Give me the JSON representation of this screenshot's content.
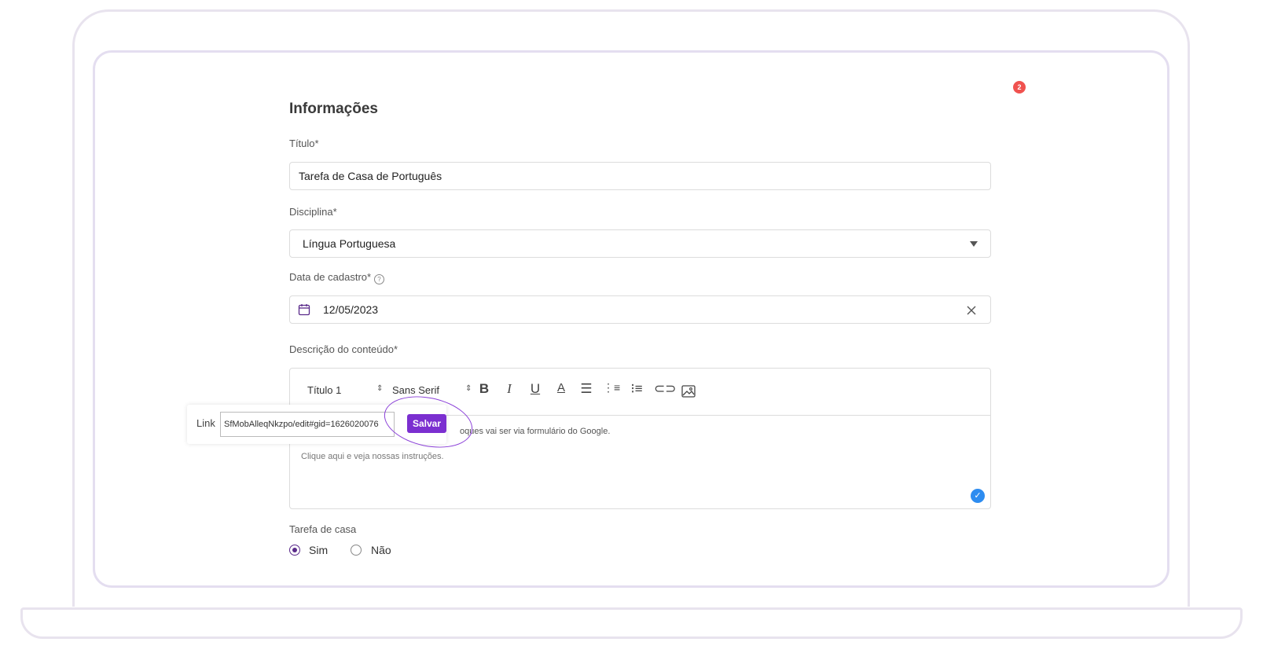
{
  "notification_count": "2",
  "form": {
    "section_title": "Informações",
    "titulo": {
      "label": "Título*",
      "value": "Tarefa de Casa de Português"
    },
    "disciplina": {
      "label": "Disciplina*",
      "value": "Língua Portuguesa"
    },
    "data": {
      "label": "Data de cadastro*",
      "value": "12/05/2023"
    },
    "descricao": {
      "label": "Descrição do conteúdo*",
      "toolbar": {
        "heading": "Título 1",
        "font": "Sans Serif"
      },
      "line1": "oques vai ser via formulário do Google.",
      "line2": "Clique aqui e veja nossas instruções."
    },
    "link_popup": {
      "label": "Link",
      "value": "SfMobAlleqNkzpo/edit#gid=1626020076",
      "save_label": "Salvar"
    },
    "tarefa_de_casa": {
      "label": "Tarefa de casa",
      "options": [
        "Sim",
        "Não"
      ],
      "selected": "Sim"
    }
  }
}
